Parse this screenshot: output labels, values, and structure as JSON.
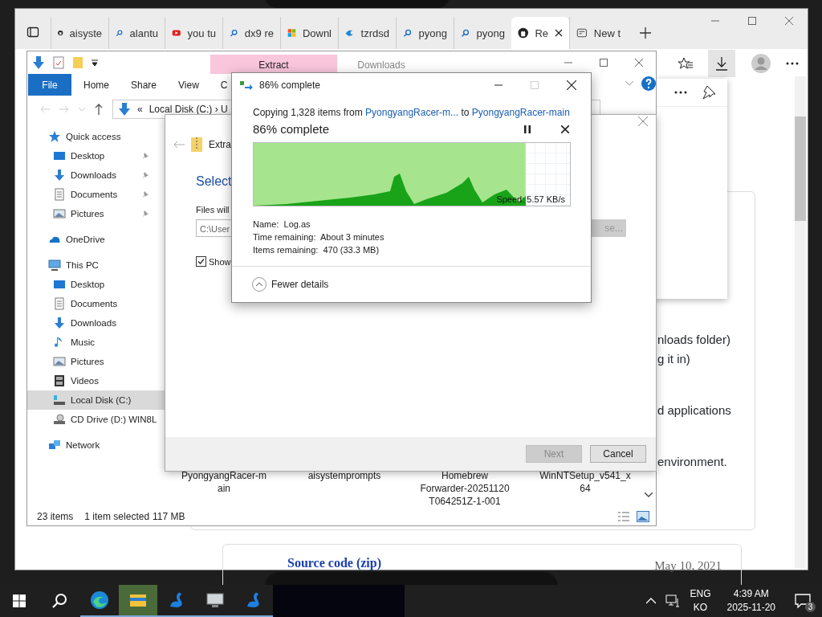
{
  "browser": {
    "tabs": [
      {
        "label": "aisyste",
        "kind": "github",
        "selected": false
      },
      {
        "label": "alantu",
        "kind": "search",
        "selected": false
      },
      {
        "label": "you tu",
        "kind": "video",
        "selected": false
      },
      {
        "label": "dx9 re",
        "kind": "search",
        "selected": false
      },
      {
        "label": "Downl",
        "kind": "tiles",
        "selected": false
      },
      {
        "label": "tzrdsd",
        "kind": "swirl",
        "selected": false
      },
      {
        "label": "pyong",
        "kind": "search",
        "selected": false
      },
      {
        "label": "pyong",
        "kind": "search",
        "selected": false
      },
      {
        "label": "Re",
        "kind": "github",
        "selected": true
      },
      {
        "label": "New t",
        "kind": "page",
        "selected": false
      }
    ],
    "page_lines": [
      "nloads folder)",
      "g it in)",
      "d applications",
      "environment."
    ],
    "release": {
      "link": "Source code (zip)",
      "date": "May 10, 2021"
    }
  },
  "explorer": {
    "contextual_tabs": [
      {
        "label": "Extract",
        "kind": "highlight"
      },
      {
        "label": "Downloads",
        "kind": "plain"
      }
    ],
    "ribbon_tabs": [
      {
        "label": "File",
        "kind": "file"
      },
      {
        "label": "Home",
        "kind": "tab"
      },
      {
        "label": "Share",
        "kind": "tab"
      },
      {
        "label": "View",
        "kind": "tab"
      },
      {
        "label": "C",
        "kind": "tab"
      }
    ],
    "address": {
      "prefix": "«",
      "path": "Local Disk (C:)  ›  U"
    },
    "nav": [
      {
        "label": "Quick access",
        "kind": "star",
        "selected": false,
        "children": [
          {
            "label": "Desktop",
            "kind": "desktop",
            "pinned": true,
            "selected": false
          },
          {
            "label": "Downloads",
            "kind": "download",
            "pinned": true,
            "selected": false
          },
          {
            "label": "Documents",
            "kind": "document",
            "pinned": true,
            "selected": false
          },
          {
            "label": "Pictures",
            "kind": "pictures",
            "pinned": true,
            "selected": false
          }
        ]
      },
      {
        "label": "OneDrive",
        "kind": "cloud",
        "selected": false
      },
      {
        "label": "This PC",
        "kind": "pc",
        "selected": false,
        "children": [
          {
            "label": "Desktop",
            "kind": "desktop",
            "pinned": false,
            "selected": false
          },
          {
            "label": "Documents",
            "kind": "document",
            "pinned": false,
            "selected": false
          },
          {
            "label": "Downloads",
            "kind": "download",
            "pinned": false,
            "selected": false
          },
          {
            "label": "Music",
            "kind": "music",
            "pinned": false,
            "selected": false
          },
          {
            "label": "Pictures",
            "kind": "pictures",
            "pinned": false,
            "selected": false
          },
          {
            "label": "Videos",
            "kind": "video",
            "pinned": false,
            "selected": false
          },
          {
            "label": "Local Disk (C:)",
            "kind": "disk",
            "pinned": false,
            "selected": true
          },
          {
            "label": "CD Drive (D:) WIN8L",
            "kind": "cd",
            "pinned": false,
            "selected": false
          }
        ]
      },
      {
        "label": "Network",
        "kind": "network",
        "selected": false
      }
    ],
    "files": [
      {
        "lines": [
          "PyongyangRacer-m",
          "ain"
        ]
      },
      {
        "lines": [
          "aisystemprompts"
        ]
      },
      {
        "lines": [
          "Homebrew",
          "Forwarder-20251120",
          "T064251Z-1-001"
        ]
      },
      {
        "lines": [
          "WinNTSetup_v541_x",
          "64"
        ]
      }
    ],
    "status": {
      "count": "23 items",
      "selection": "1 item selected",
      "size": "117 MB"
    }
  },
  "extract_wizard": {
    "title": "Extra",
    "heading": "Select",
    "label": "Files will",
    "path": "C:\\User",
    "show_checkbox": {
      "label": "Show",
      "checked": true
    },
    "browse": {
      "label": "se...",
      "disabled": true
    },
    "buttons": [
      {
        "label": "Next",
        "disabled": true
      },
      {
        "label": "Cancel",
        "disabled": false
      }
    ]
  },
  "copy_dialog": {
    "title": "86% complete",
    "copying": {
      "prefix": "Copying 1,328 items from",
      "source": "PyongyangRacer-m...",
      "middle": "to",
      "destination": "PyongyangRacer-main"
    },
    "heading": "86% complete",
    "level": 0.86,
    "speed": "Speed: 5.57 KB/s",
    "details": [
      "Name:  Log.as",
      "Time remaining:  About 3 minutes",
      "Items remaining:  470 (33.3 MB)"
    ],
    "toggle": "Fewer details"
  },
  "taskbar": {
    "apps": [
      {
        "kind": "edge",
        "active": false
      },
      {
        "kind": "folder",
        "active": true
      },
      {
        "kind": "swan",
        "active": false
      },
      {
        "kind": "monitor",
        "active": false
      },
      {
        "kind": "swan",
        "active": false
      }
    ],
    "language": [
      "ENG",
      "KO"
    ],
    "time": "4:39 AM",
    "date": "2025-11-20",
    "notifications": "3"
  }
}
